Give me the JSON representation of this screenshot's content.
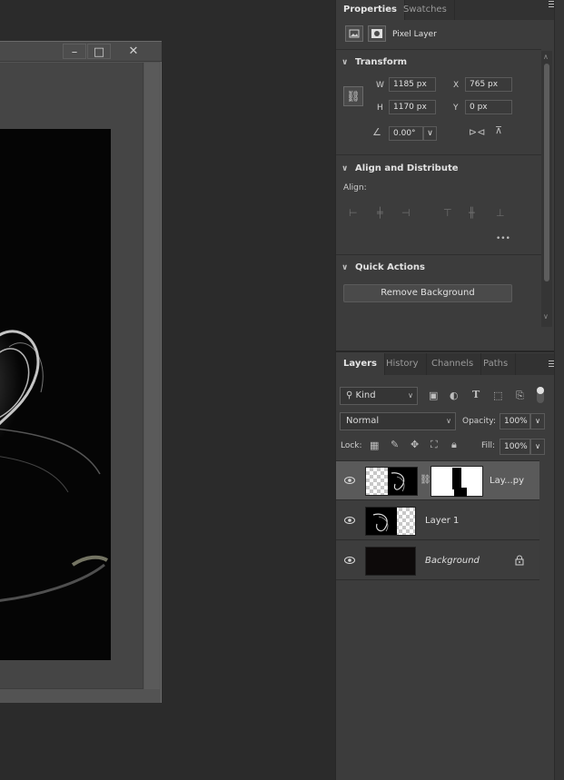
{
  "document": {
    "window_buttons": {
      "minimize": "–",
      "maximize": "□",
      "close": "✕"
    }
  },
  "properties_panel": {
    "tabs": [
      "Properties",
      "Swatches"
    ],
    "active_tab": "Properties",
    "layer_type": "Pixel Layer",
    "transform": {
      "title": "Transform",
      "w_label": "W",
      "w_value": "1185 px",
      "h_label": "H",
      "h_value": "1170 px",
      "x_label": "X",
      "x_value": "765 px",
      "y_label": "Y",
      "y_value": "0 px",
      "angle_value": "0.00°"
    },
    "align": {
      "title": "Align and Distribute",
      "align_label": "Align:",
      "more": "•••"
    },
    "quick_actions": {
      "title": "Quick Actions",
      "remove_background": "Remove Background"
    }
  },
  "layers_panel": {
    "tabs": [
      "Layers",
      "History",
      "Channels",
      "Paths"
    ],
    "active_tab": "Layers",
    "filter_kind": "Kind",
    "blend_mode": "Normal",
    "opacity_label": "Opacity:",
    "opacity_value": "100%",
    "lock_label": "Lock:",
    "fill_label": "Fill:",
    "fill_value": "100%",
    "layers": [
      {
        "name": "Lay...py",
        "selected": true,
        "has_mask": true,
        "italic": false
      },
      {
        "name": "Layer 1",
        "selected": false,
        "has_mask": false,
        "italic": false
      },
      {
        "name": "Background",
        "selected": false,
        "has_mask": false,
        "italic": true,
        "locked": true
      }
    ]
  },
  "colors": {
    "app_bg": "#2b2b2b",
    "panel_bg": "#3c3c3c",
    "selected_row": "#5a5a5a"
  }
}
